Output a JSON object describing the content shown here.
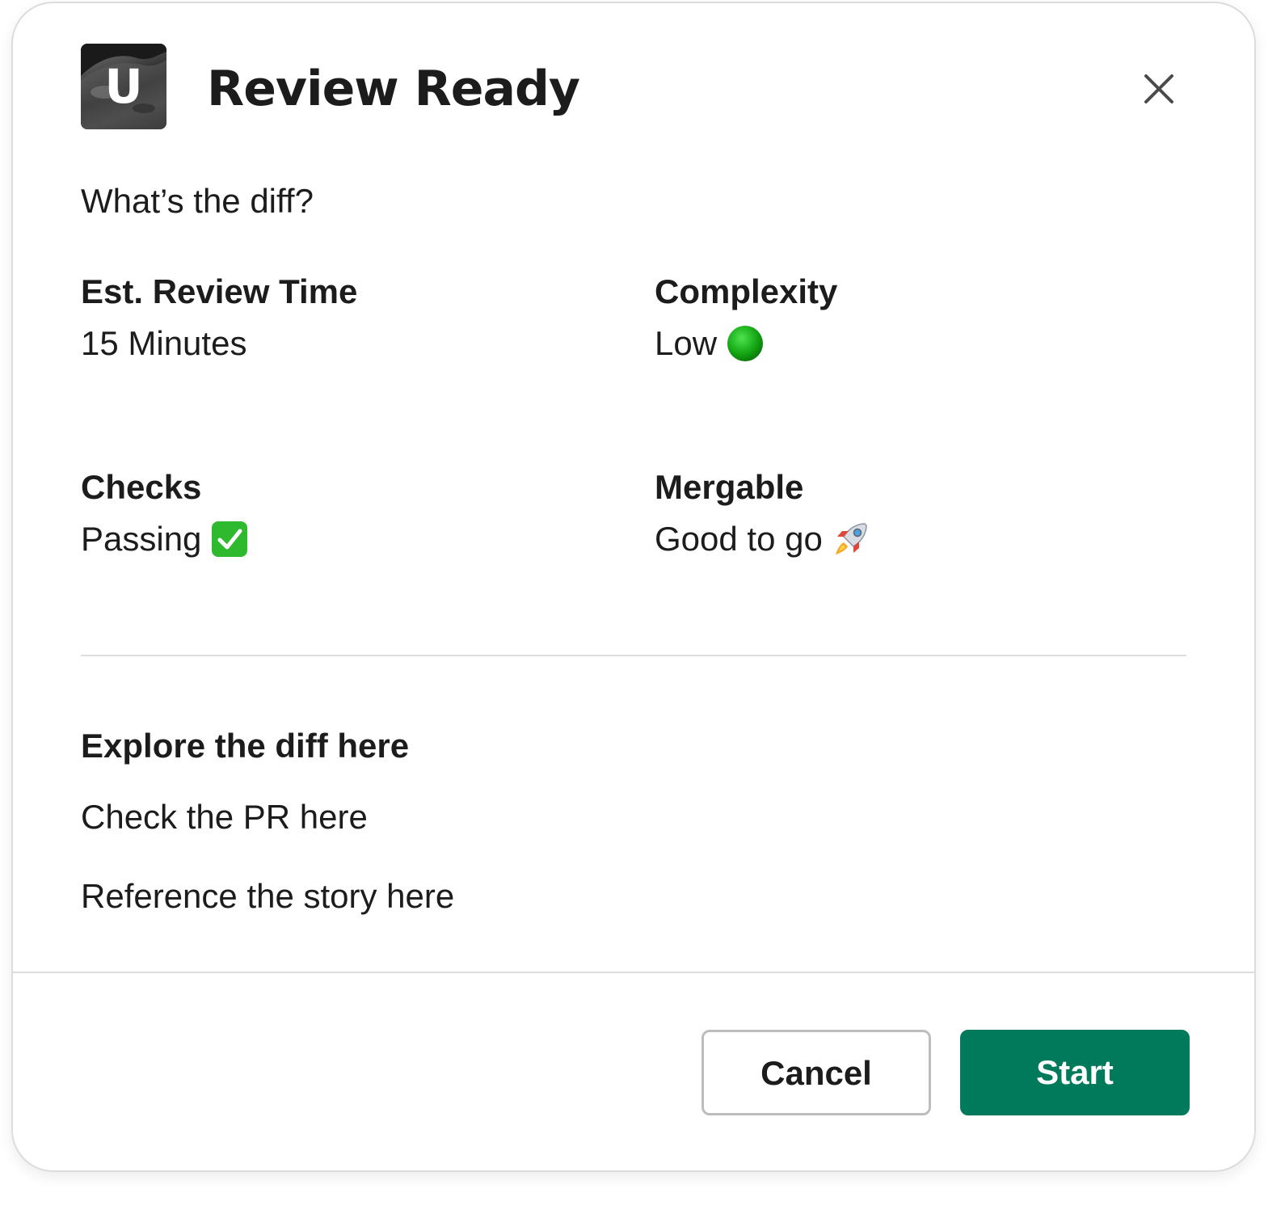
{
  "modal": {
    "app_icon_letter": "U",
    "title": "Review Ready",
    "intro": "What’s the diff?"
  },
  "fields": {
    "review_time": {
      "label": "Est. Review Time",
      "value": "15 Minutes"
    },
    "complexity": {
      "label": "Complexity",
      "value": "Low",
      "icon": "green-circle-icon"
    },
    "checks": {
      "label": "Checks",
      "value": "Passing",
      "icon": "check-mark-button-icon"
    },
    "mergable": {
      "label": "Mergable",
      "value": "Good to go",
      "icon": "rocket-icon"
    }
  },
  "links": {
    "section_title": "Explore the diff here",
    "pr": "Check the PR here",
    "story": "Reference the story here"
  },
  "footer": {
    "cancel_label": "Cancel",
    "start_label": "Start"
  },
  "colors": {
    "primary": "#007a5a",
    "text": "#1d1c1d",
    "divider": "#dddddd"
  }
}
